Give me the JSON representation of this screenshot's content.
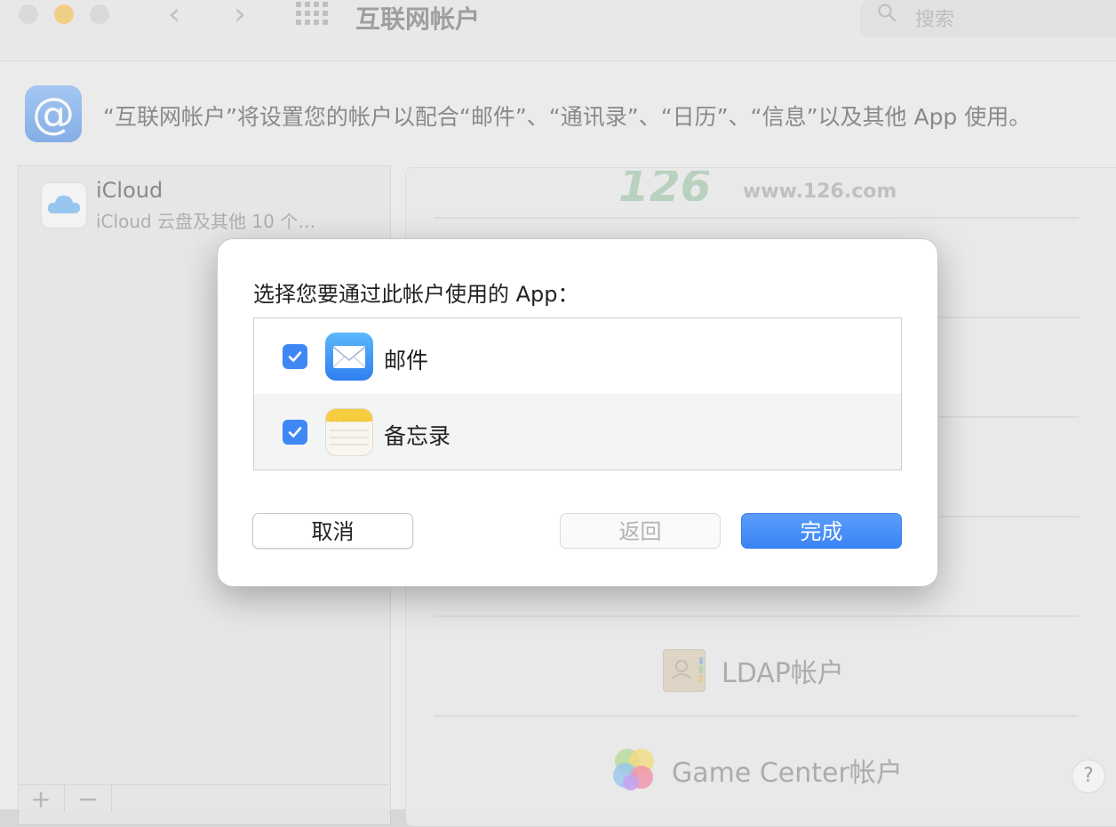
{
  "window": {
    "title": "互联网帐户",
    "search_placeholder": "搜索"
  },
  "info": {
    "icon": "at-icon",
    "text": "“互联网帐户”将设置您的帐户以配合“邮件”、“通讯录”、“日历”、“信息”以及其他 App 使用。"
  },
  "accounts": [
    {
      "name": "iCloud",
      "detail": "iCloud 云盘及其他 10 个…",
      "icon": "icloud-icon"
    }
  ],
  "list_controls": {
    "add": "+",
    "remove": "−"
  },
  "providers": {
    "logo_126_digits": "126",
    "logo_126_url": "www.126.com",
    "ldap": "LDAP帐户",
    "game_center": "Game Center帐户"
  },
  "help_label": "?",
  "dialog": {
    "prompt": "选择您要通过此帐户使用的 App：",
    "apps": [
      {
        "name": "邮件",
        "checked": true,
        "icon": "mail-icon"
      },
      {
        "name": "备忘录",
        "checked": true,
        "icon": "notes-icon"
      }
    ],
    "buttons": {
      "cancel": "取消",
      "back": "返回",
      "done": "完成"
    }
  },
  "colors": {
    "accent": "#3f87f5",
    "minimize": "#f5bf4f"
  }
}
